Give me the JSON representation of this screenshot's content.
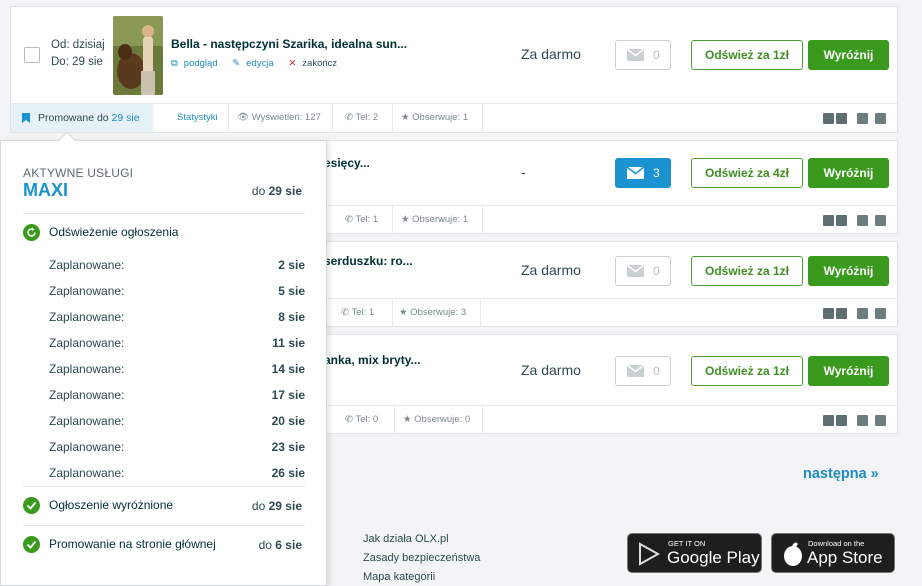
{
  "ads": [
    {
      "date_from": "Od: dzisiaj",
      "date_to": "Do: 29 sie",
      "title": "Bella - następczyni Szarika, idealna sun...",
      "preview_label": "podgląd",
      "edit_label": "edycja",
      "end_label": "zakończ",
      "price": "Za darmo",
      "messages": "0",
      "refresh_label": "Odśwież za 1zł",
      "feature_label": "Wyróżnij",
      "promoted_label": "Promowane do",
      "promoted_until": "29 sie",
      "stats_label": "Statystyki",
      "views": "Wyświetleń: 127",
      "phone": "Tel: 2",
      "watching": "Obserwuje: 1"
    },
    {
      "title": "esięcy...",
      "price": "-",
      "messages": "3",
      "refresh_label": "Odśwież za 4zł",
      "feature_label": "Wyróżnij",
      "phone": "Tel: 1",
      "watching": "Obserwuje: 1"
    },
    {
      "title": "serduszku: ro...",
      "price": "Za darmo",
      "messages": "0",
      "refresh_label": "Odśwież za 1zł",
      "feature_label": "Wyróżnij",
      "phone": "Tel: 1",
      "watching": "Obserwuje: 3"
    },
    {
      "title": "anka, mix bryty...",
      "price": "Za darmo",
      "messages": "0",
      "refresh_label": "Odśwież za 1zł",
      "feature_label": "Wyróżnij",
      "phone": "Tel: 0",
      "watching": "Obserwuje: 0"
    }
  ],
  "popover": {
    "heading": "AKTYWNE USŁUGI",
    "package": "MAXI",
    "until_prefix": "do",
    "until_date": "29 sie",
    "refresh_service": "Odświeżenie ogłoszenia",
    "scheduled_label": "Zaplanowane:",
    "scheduled_dates": [
      "2 sie",
      "5 sie",
      "8 sie",
      "11 sie",
      "14 sie",
      "17 sie",
      "20 sie",
      "23 sie",
      "26 sie"
    ],
    "featured_service": "Ogłoszenie wyróżnione",
    "featured_until": "29 sie",
    "homepage_service": "Promowanie na stronie głównej",
    "homepage_until": "6 sie"
  },
  "pagination": {
    "next_label": "następna »"
  },
  "footer": {
    "links": [
      "Jak działa OLX.pl",
      "Zasady bezpieczeństwa",
      "Mapa kategorii"
    ],
    "google_play_top": "GET IT ON",
    "google_play": "Google Play",
    "app_store_top": "Download on the",
    "app_store": "App Store"
  },
  "colors": {
    "accent": "#1b93d1",
    "green": "#3a9a1e",
    "text": "#002f34"
  }
}
